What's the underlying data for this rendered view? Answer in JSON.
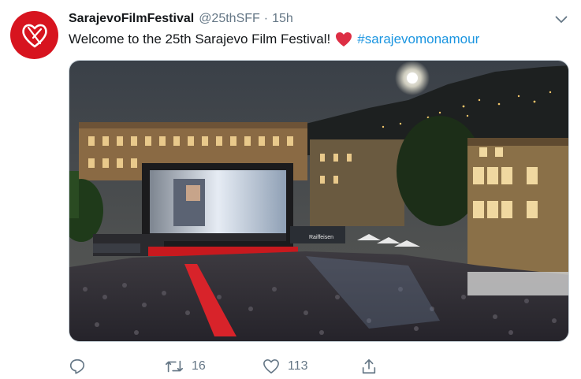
{
  "tweet": {
    "display_name": "SarajevoFilmFestival",
    "handle": "@25thSFF",
    "separator": "·",
    "time": "15h",
    "text_before": "Welcome to the 25th Sarajevo Film Festival!",
    "emoji": "red-heart",
    "hashtag": "#sarajevomonamour"
  },
  "media": {
    "screen_sign": "Raiffeisen",
    "description_icon": "outdoor-cinema-photo"
  },
  "actions": {
    "reply_count": "",
    "retweet_count": "16",
    "like_count": "113"
  },
  "colors": {
    "brand_red": "#d7141f",
    "link_blue": "#1b95e0",
    "secondary_text": "#657786"
  }
}
